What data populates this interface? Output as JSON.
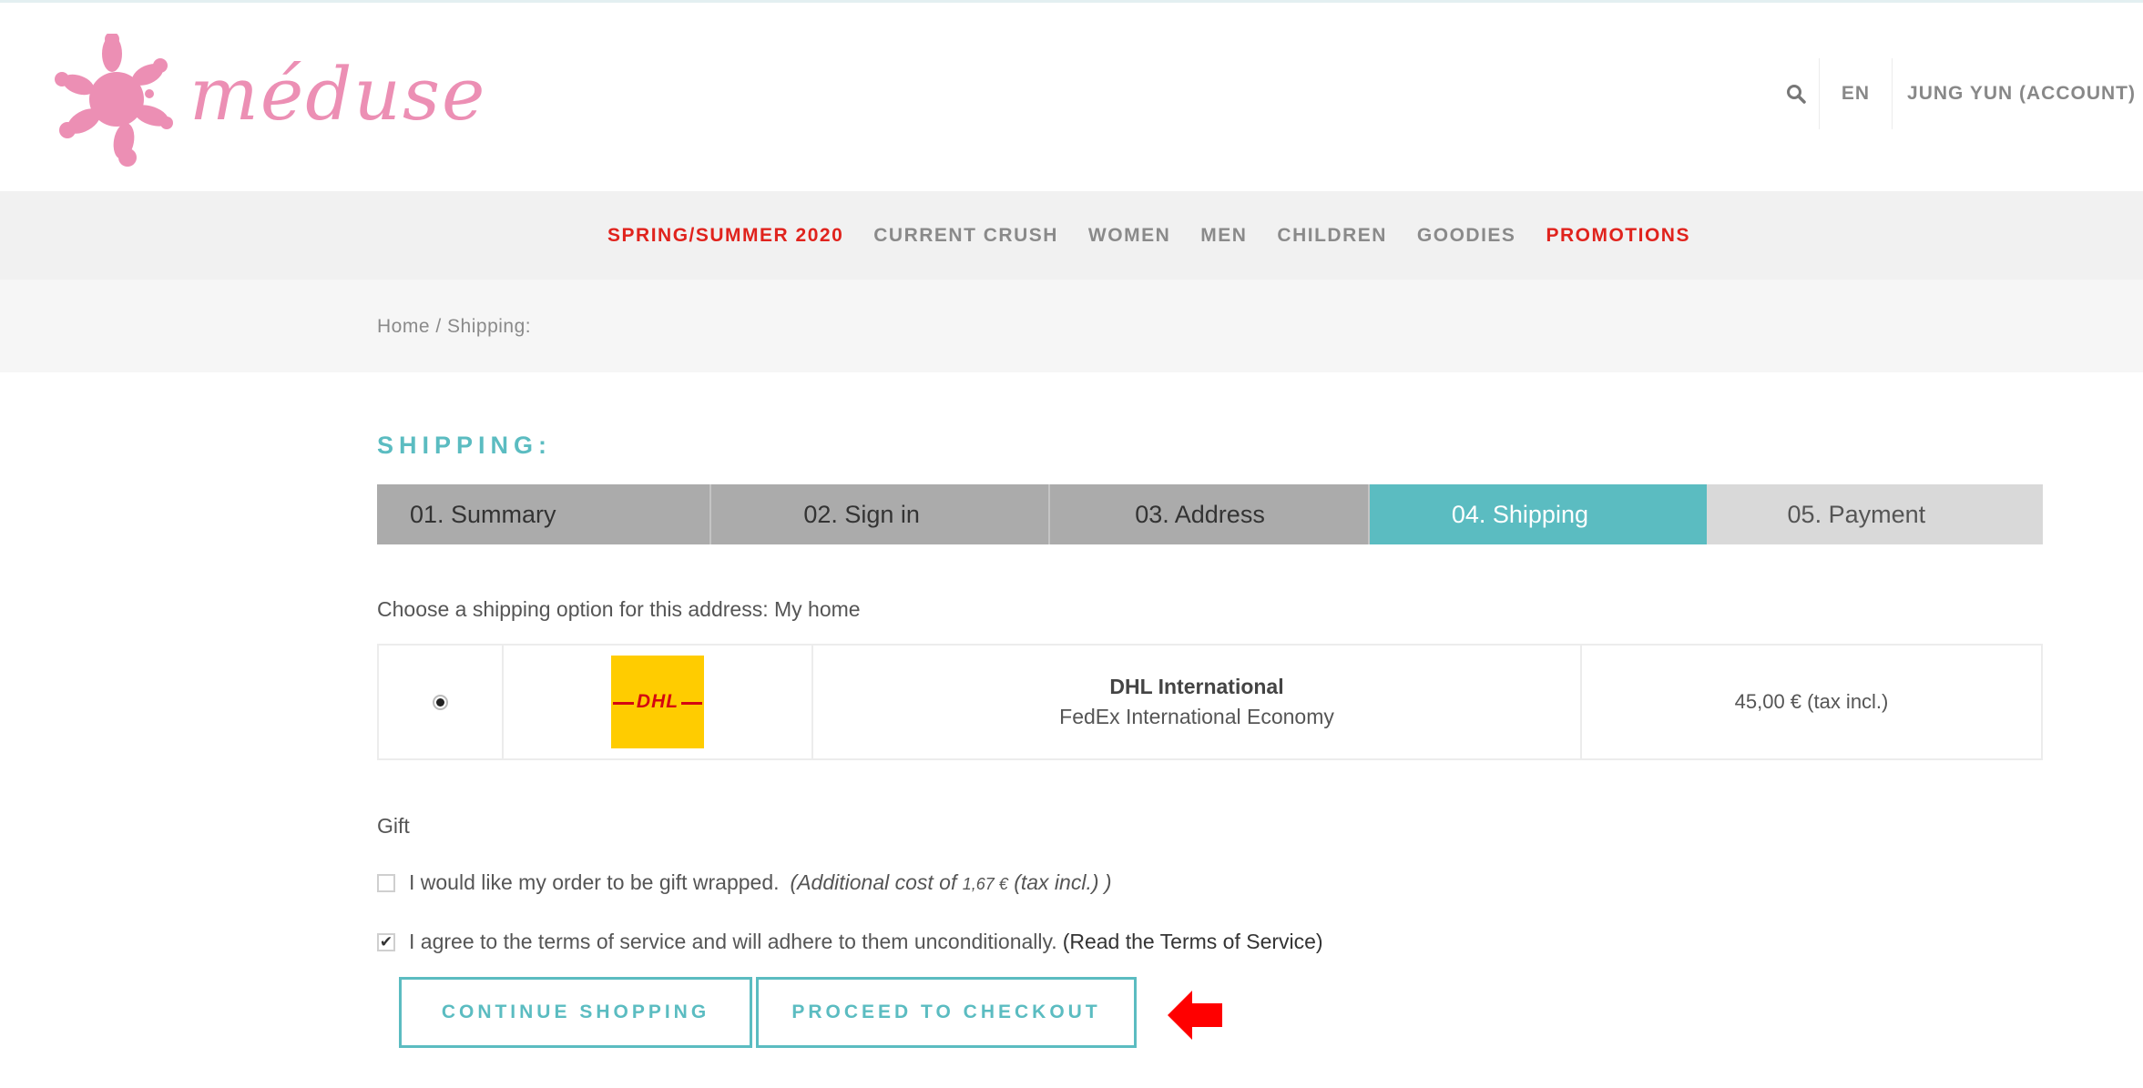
{
  "header": {
    "logo_text": "méduse",
    "lang": "EN",
    "account": "JUNG YUN (ACCOUNT)"
  },
  "nav": {
    "items": [
      {
        "label": "SPRING/SUMMER 2020",
        "highlight": true
      },
      {
        "label": "CURRENT CRUSH",
        "highlight": false
      },
      {
        "label": "WOMEN",
        "highlight": false
      },
      {
        "label": "MEN",
        "highlight": false
      },
      {
        "label": "CHILDREN",
        "highlight": false
      },
      {
        "label": "GOODIES",
        "highlight": false
      },
      {
        "label": "PROMOTIONS",
        "highlight": true
      }
    ]
  },
  "breadcrumb": {
    "home": "Home",
    "separator": " / ",
    "current": "Shipping:"
  },
  "page": {
    "title": "SHIPPING:"
  },
  "steps": [
    {
      "label": "01. Summary",
      "state": "done"
    },
    {
      "label": "02. Sign in",
      "state": "done"
    },
    {
      "label": "03. Address",
      "state": "done"
    },
    {
      "label": "04. Shipping",
      "state": "active"
    },
    {
      "label": "05. Payment",
      "state": "todo"
    }
  ],
  "shipping": {
    "prompt": "Choose a shipping option for this address: My home",
    "option": {
      "selected": true,
      "logo_text": "DHL",
      "name": "DHL International",
      "delay": "FedEx International Economy",
      "price": "45,00 € (tax incl.)"
    }
  },
  "gift": {
    "heading": "Gift",
    "checkbox_label": "I would like my order to be gift wrapped.",
    "extra_prefix": "(Additional cost of ",
    "extra_amount": "1,67 €",
    "extra_suffix": " (tax incl.) )",
    "checked": false
  },
  "terms": {
    "label": "I agree to the terms of service and will adhere to them unconditionally.",
    "link": "(Read the Terms of Service)",
    "checked": true,
    "check_glyph": "✔"
  },
  "buttons": {
    "continue": "CONTINUE SHOPPING",
    "checkout": "PROCEED TO CHECKOUT"
  },
  "colors": {
    "accent": "#5bbcc1",
    "brand_pink": "#ec8fb4",
    "nav_red": "#e0231d",
    "arrow_red": "#ff0000",
    "dhl_yellow": "#ffcc00",
    "dhl_red": "#d40511"
  },
  "icons": {
    "search": "search-icon",
    "arrow": "arrow-left-icon"
  }
}
